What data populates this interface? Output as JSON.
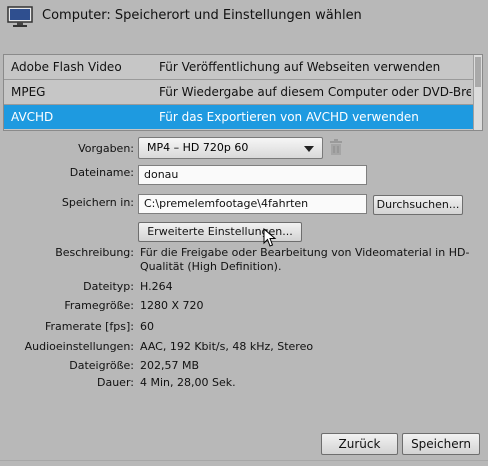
{
  "window": {
    "title": "Computer: Speicherort und Einstellungen wählen"
  },
  "formats": [
    {
      "name": "Adobe Flash Video",
      "description": "Für Veröffentlichung auf Webseiten verwenden"
    },
    {
      "name": "MPEG",
      "description": "Für Wiedergabe auf diesem Computer oder DVD-Bren..."
    },
    {
      "name": "AVCHD",
      "description": "Für das Exportieren von AVCHD verwenden"
    }
  ],
  "form": {
    "vorgaben_label": "Vorgaben:",
    "vorgaben_value": "MP4 – HD 720p 60",
    "dateiname_label": "Dateiname:",
    "dateiname_value": "donau",
    "speichern_label": "Speichern in:",
    "speichern_value": "C:\\premelemfootage\\4fahrten",
    "durchsuchen_label": "Durchsuchen...",
    "erweitert_label": "Erweiterte Einstellungen..."
  },
  "info": {
    "beschreibung_label": "Beschreibung:",
    "beschreibung_value": "Für die Freigabe oder Bearbeitung von Videomaterial in HD-Qualität (High Definition).",
    "dateityp_label": "Dateityp:",
    "dateityp_value": "H.264",
    "framegroesse_label": "Framegröße:",
    "framegroesse_value": "1280 X 720",
    "framerate_label": "Framerate [fps]:",
    "framerate_value": "60",
    "audio_label": "Audioeinstellungen:",
    "audio_value": "AAC, 192 Kbit/s, 48 kHz, Stereo",
    "dateigroesse_label": "Dateigröße:",
    "dateigroesse_value": "202,57 MB",
    "dauer_label": "Dauer:",
    "dauer_value": "4 Min, 28,00 Sek."
  },
  "footer": {
    "back_label": "Zurück",
    "save_label": "Speichern"
  },
  "icons": {
    "header": "monitor-icon",
    "trash": "trash-icon",
    "dropdown": "chevron-down-icon",
    "cursor": "mouse-cursor-icon"
  },
  "colors": {
    "background": "#b8b8b8",
    "selection": "#1e9ae0"
  }
}
